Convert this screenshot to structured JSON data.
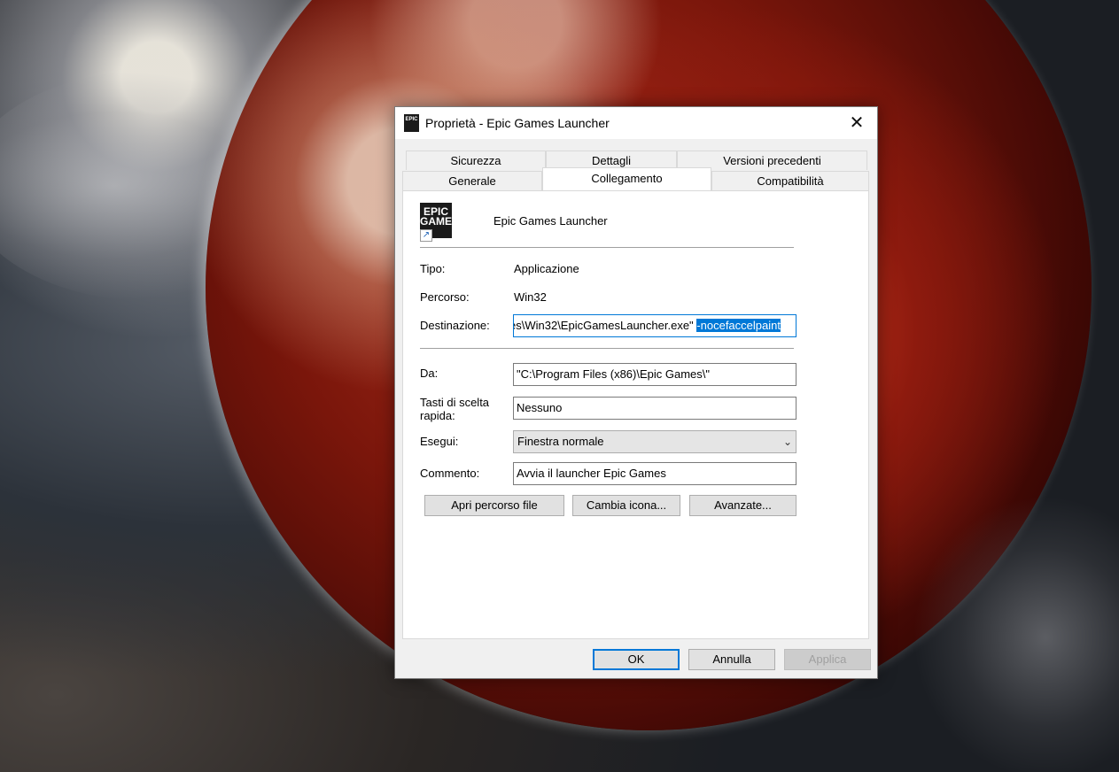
{
  "dialog": {
    "title": "Proprietà - Epic Games Launcher",
    "close_symbol": "✕",
    "title_icon_text": "EPIC",
    "tabs_row_back": [
      "Sicurezza",
      "Dettagli",
      "Versioni precedenti"
    ],
    "tabs_row_front": [
      "Generale",
      "Collegamento",
      "Compatibilità"
    ],
    "active_tab": "Collegamento"
  },
  "shortcut": {
    "app_icon_text": "EPIC\nGAMES",
    "app_name": "Epic Games Launcher",
    "tipo_label": "Tipo:",
    "tipo_value": "Applicazione",
    "percorso_label": "Percorso:",
    "percorso_value": "Win32",
    "destinazione_label": "Destinazione:",
    "destinazione_value": "es\\Win32\\EpicGamesLauncher.exe\" ",
    "destinazione_selected": "-nocefaccelpaint",
    "da_label": "Da:",
    "da_value": "\"C:\\Program Files (x86)\\Epic Games\\\"",
    "tasti_label": "Tasti di scelta rapida:",
    "tasti_value": "Nessuno",
    "esegui_label": "Esegui:",
    "esegui_value": "Finestra normale",
    "commento_label": "Commento:",
    "commento_value": "Avvia il launcher Epic Games"
  },
  "actions": {
    "apri": "Apri percorso file",
    "cambia": "Cambia icona...",
    "avanzate": "Avanzate..."
  },
  "footer": {
    "ok": "OK",
    "annulla": "Annulla",
    "applica": "Applica"
  },
  "colors": {
    "accent": "#0078d7",
    "dialog_bg": "#f0f0f0",
    "panel_bg": "#ffffff"
  }
}
